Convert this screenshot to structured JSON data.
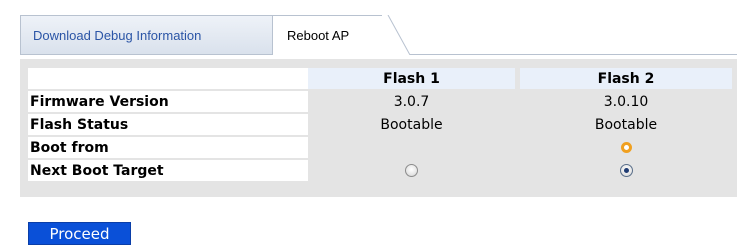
{
  "tabs": [
    {
      "label": "Download Debug Information",
      "active": false
    },
    {
      "label": "Reboot AP",
      "active": true
    }
  ],
  "table": {
    "columns": [
      "",
      "Flash 1",
      "Flash 2"
    ],
    "rows": [
      {
        "label": "Firmware Version",
        "flash1": "3.0.7",
        "flash2": "3.0.10"
      },
      {
        "label": "Flash Status",
        "flash1": "Bootable",
        "flash2": "Bootable"
      },
      {
        "label": "Boot from",
        "flash1": "",
        "flash2": "active-indicator"
      },
      {
        "label": "Next Boot Target",
        "flash1": "radio-unselected",
        "flash2": "radio-selected"
      }
    ]
  },
  "actions": {
    "proceed_label": "Proceed"
  },
  "colors": {
    "tab_link": "#2b55a6",
    "header_bg": "#e9f0fa",
    "panel_bg": "#e4e4e4",
    "button_bg": "#0a50d8",
    "boot_indicator": "#f0a020"
  }
}
